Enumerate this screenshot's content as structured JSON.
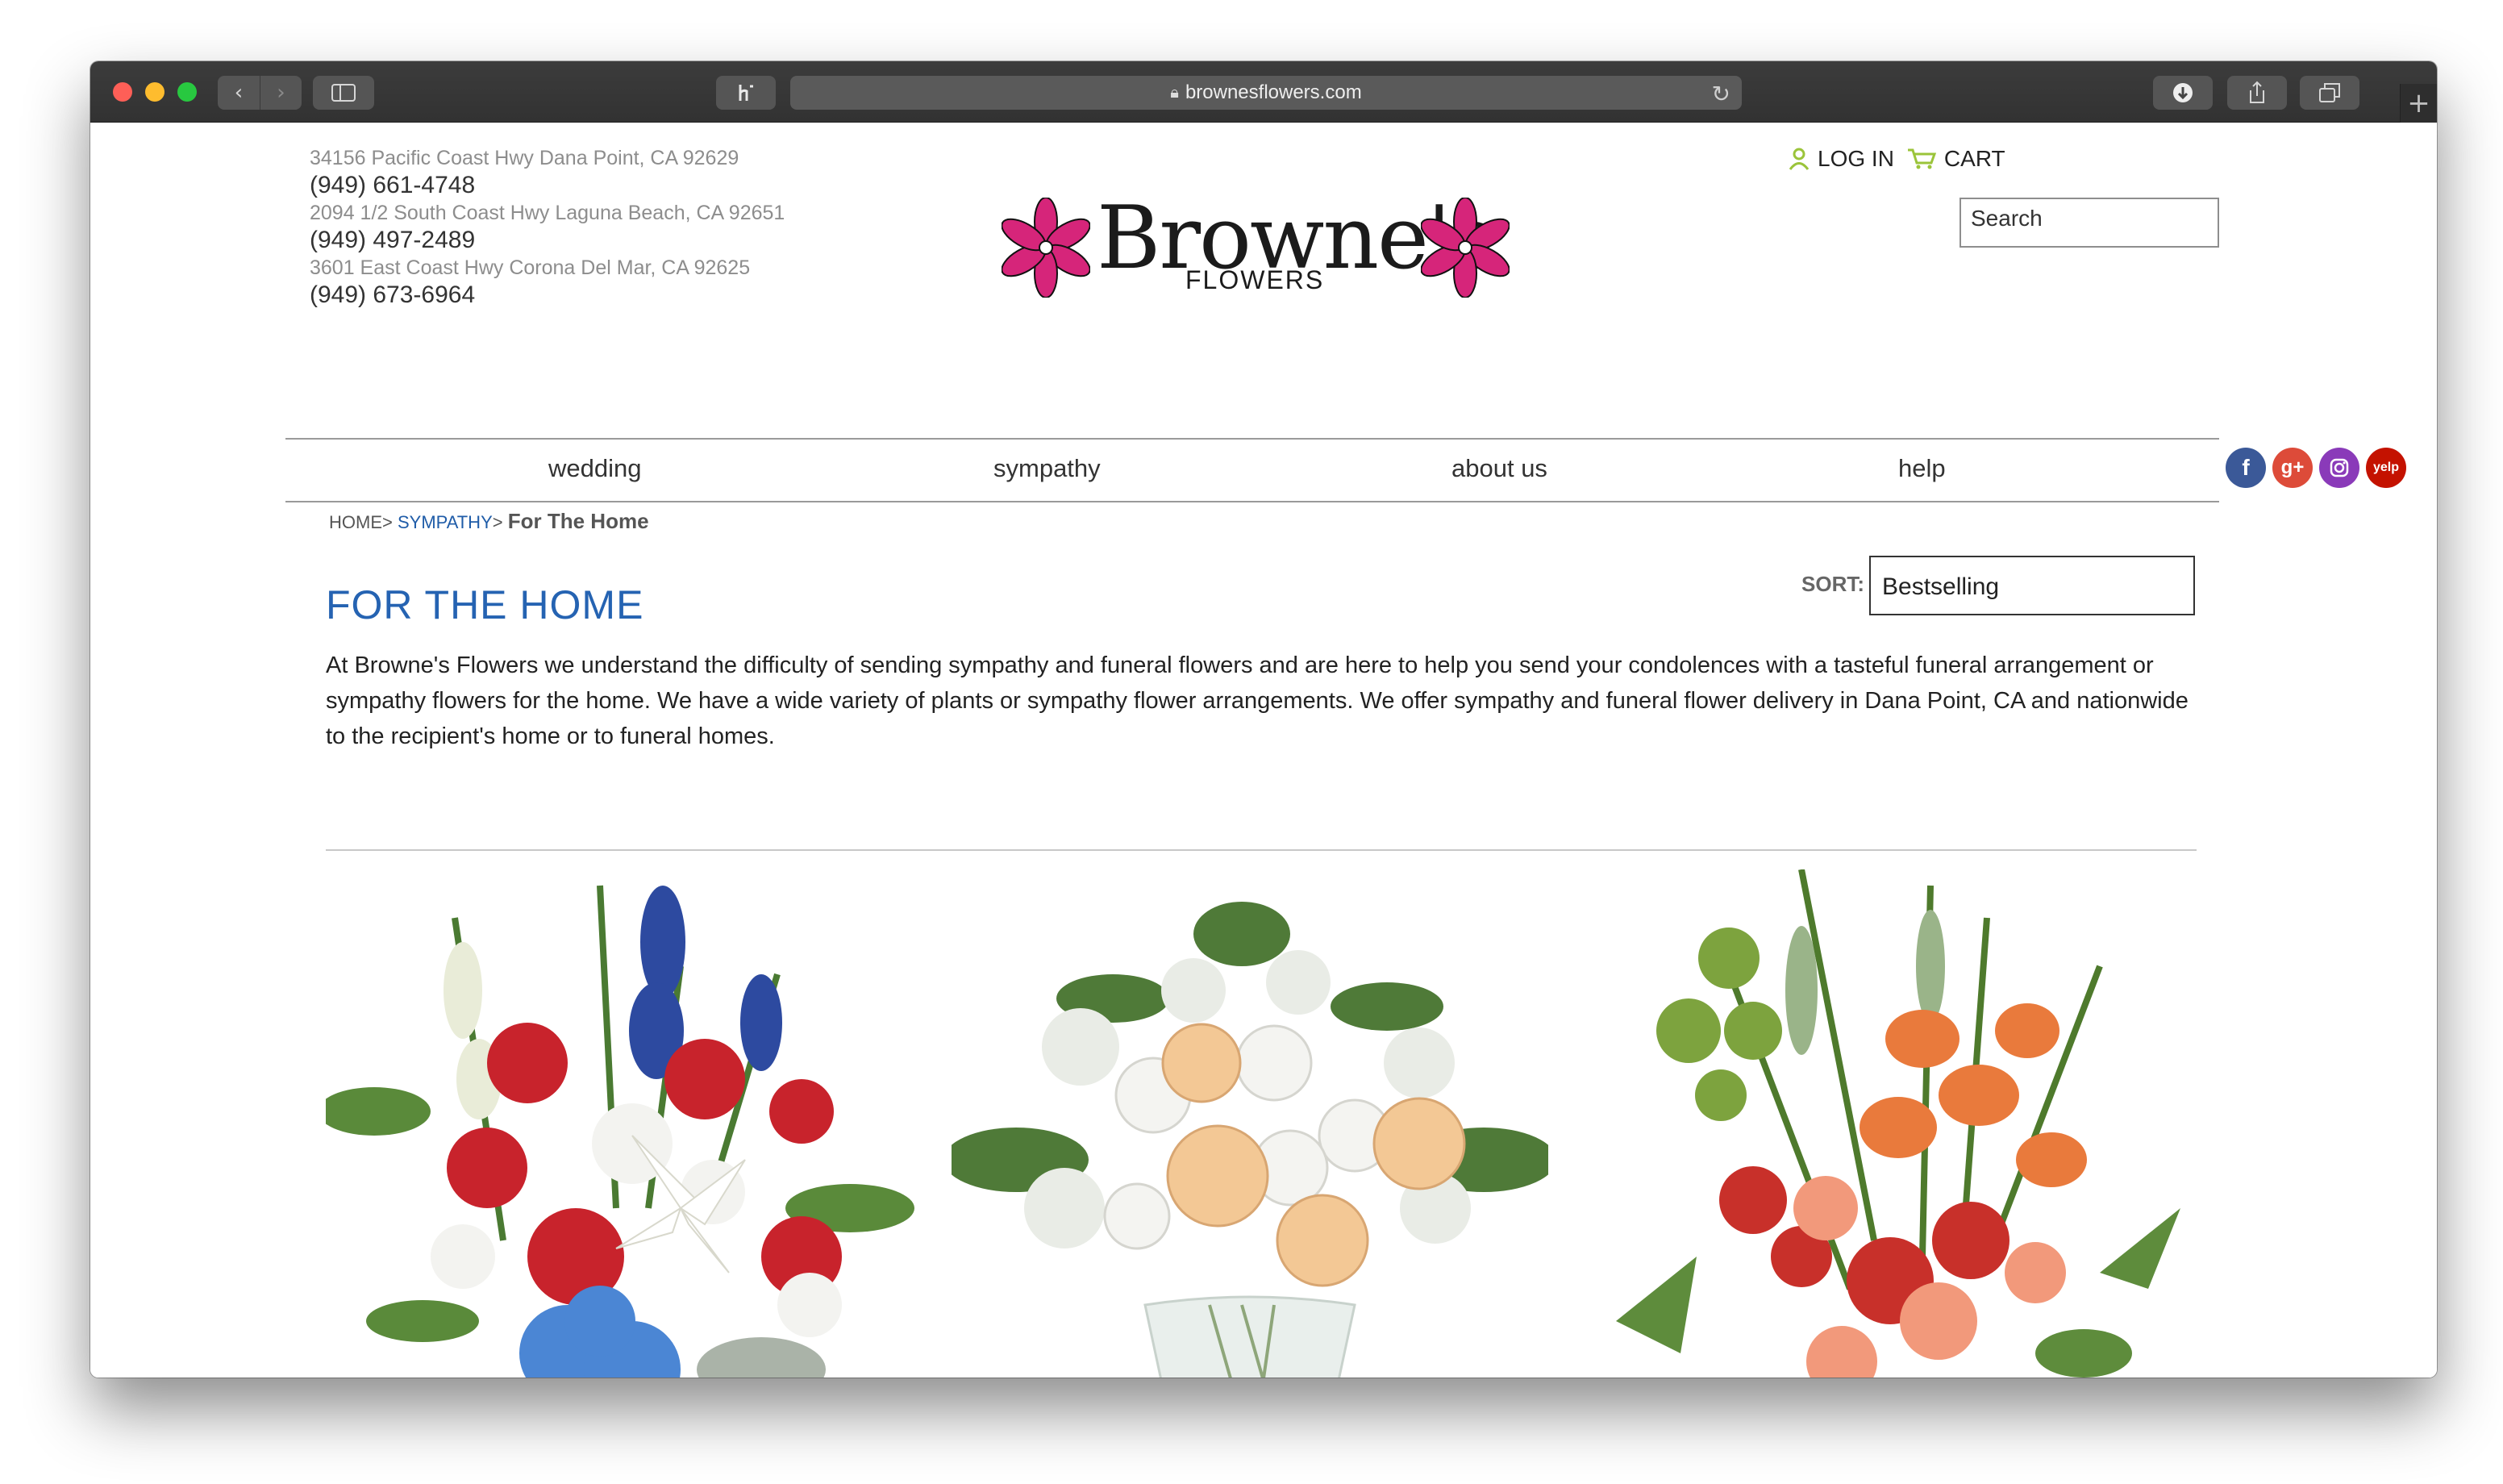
{
  "browser": {
    "url": "brownesflowers.com"
  },
  "header": {
    "locations": [
      {
        "address": "34156 Pacific Coast Hwy Dana Point, CA 92629",
        "phone": "(949) 661-4748"
      },
      {
        "address": "2094 1/2 South Coast Hwy Laguna Beach, CA 92651",
        "phone": "(949) 497-2489"
      },
      {
        "address": "3601 East Coast Hwy Corona Del Mar, CA 92625",
        "phone": "(949) 673-6964"
      }
    ],
    "logo": {
      "name": "Browne's",
      "sub": "FLOWERS"
    },
    "login_label": "LOG IN",
    "cart_label": "CART",
    "search_placeholder": "Search"
  },
  "nav": {
    "items": [
      "wedding",
      "sympathy",
      "about us",
      "help"
    ],
    "social": [
      "facebook-icon",
      "google-plus-icon",
      "instagram-icon",
      "yelp-icon"
    ]
  },
  "breadcrumb": {
    "home": "HOME",
    "sep1": ">",
    "section": "SYMPATHY",
    "sep2": ">",
    "current": "For The Home"
  },
  "sort": {
    "label": "SORT:",
    "selected": "Bestselling"
  },
  "main": {
    "title": "FOR THE HOME",
    "intro": "At Browne's Flowers we understand the difficulty of sending sympathy and funeral flowers and are here to help you send your condolences with a tasteful funeral arrangement or sympathy flowers for the home. We have a wide variety of plants or sympathy flower arrangements. We offer sympathy and funeral flower delivery in Dana Point, CA and nationwide to the recipient's home or to funeral homes."
  },
  "colors": {
    "accent": "#2563b2",
    "link": "#1f5ca8",
    "logo_flower": "#d6257a",
    "icon_green": "#9bc43a"
  }
}
